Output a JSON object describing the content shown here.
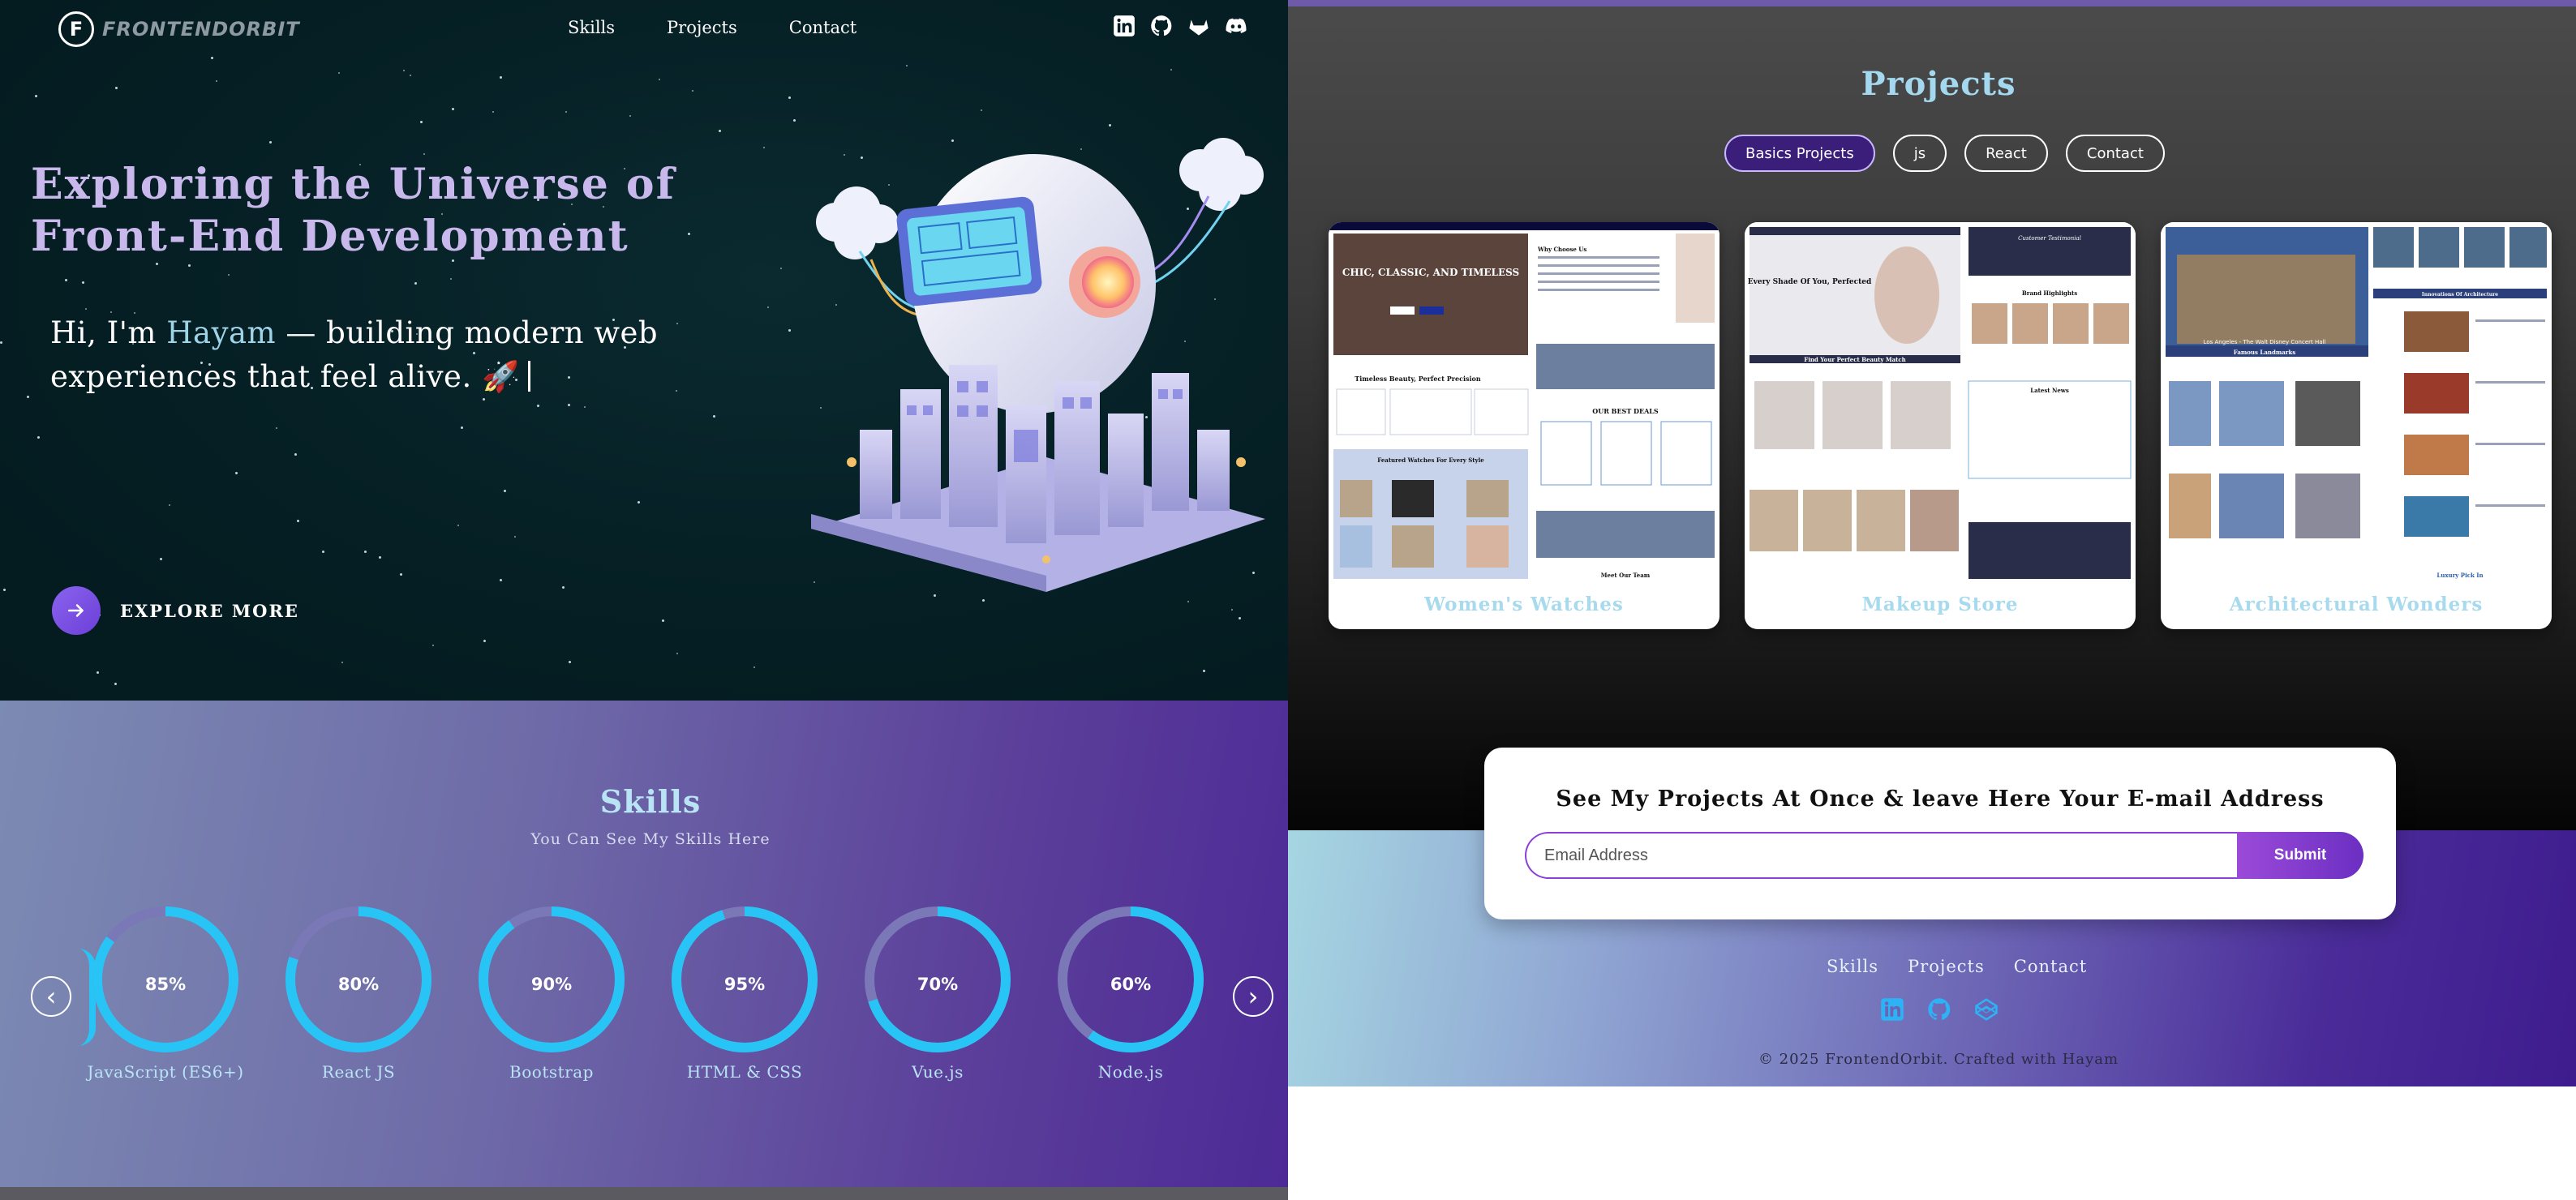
{
  "nav": {
    "logo_letter": "F",
    "logo_text": "FRONTENDORBIT",
    "links": [
      "Skills",
      "Projects",
      "Contact"
    ],
    "social_icons": [
      "linkedin-icon",
      "github-icon",
      "gitlab-icon",
      "discord-icon"
    ]
  },
  "hero": {
    "title": "Exploring the Universe of Front-End Development",
    "subtitle_pre": "Hi, I'm ",
    "subtitle_name": "Hayam",
    "subtitle_post": " — building modern web experiences that feel alive. 🚀",
    "cta": "EXPLORE MORE"
  },
  "skills": {
    "title": "Skills",
    "subtitle": "You Can See My Skills Here",
    "prev": "‹",
    "next": "›",
    "items": [
      {
        "name": "JavaScript (ES6+)",
        "percent": 85,
        "label": "85%"
      },
      {
        "name": "React JS",
        "percent": 80,
        "label": "80%"
      },
      {
        "name": "Bootstrap",
        "percent": 90,
        "label": "90%"
      },
      {
        "name": "HTML & CSS",
        "percent": 95,
        "label": "95%"
      },
      {
        "name": "Vue.js",
        "percent": 70,
        "label": "70%"
      },
      {
        "name": "Node.js",
        "percent": 60,
        "label": "60%"
      }
    ],
    "ring_color": "#29c4f6",
    "track_color": "#7b78b8"
  },
  "projects": {
    "title": "Projects",
    "filters": [
      {
        "label": "Basics Projects",
        "active": true
      },
      {
        "label": "js",
        "active": false
      },
      {
        "label": "React",
        "active": false
      },
      {
        "label": "Contact",
        "active": false
      }
    ],
    "cards": [
      {
        "caption": "Women's Watches",
        "thumb": {
          "hero": "CHIC, CLASSIC, AND TIMELESS",
          "section1": "Timeless Beauty, Perfect Precision",
          "section2": "Featured Watches For Every Style",
          "side": "Why Choose Us",
          "side2": "OUR BEST DEALS",
          "side3": "Meet Our Team"
        }
      },
      {
        "caption": "Makeup Store",
        "thumb": {
          "hero": "Every Shade Of You, Perfected",
          "section1": "Find Your Perfect Beauty Match",
          "side": "Customer Testimonial",
          "side2": "Brand Highlights",
          "side3": "Latest News"
        }
      },
      {
        "caption": "Architectural Wonders",
        "thumb": {
          "hero": "Los Angeles - The Walt Disney Concert Hall",
          "section1": "Famous Landmarks",
          "side": "Innovations Of Architecture",
          "side2": "Luxury Pick In"
        }
      }
    ]
  },
  "subscribe": {
    "title": "See My Projects At Once & leave Here Your E-mail Address",
    "placeholder": "Email Address",
    "button": "Submit"
  },
  "footer": {
    "links": [
      "Skills",
      "Projects",
      "Contact"
    ],
    "icons": [
      "linkedin-icon",
      "github-icon",
      "codepen-icon"
    ],
    "copyright": "© 2025 FrontendOrbit. Crafted with Hayam"
  }
}
